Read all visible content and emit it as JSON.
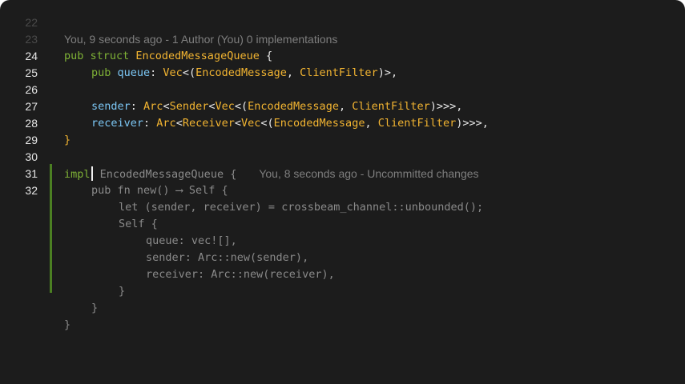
{
  "line_numbers": [
    "22",
    "23",
    "24",
    "25",
    "26",
    "27",
    "28",
    "29",
    "30",
    "31",
    "32"
  ],
  "blame_header": "You, 9 seconds ago - 1 Author (You) 0 implementations",
  "code": {
    "l24": {
      "kw": "pub struct ",
      "name": "EncodedMessageQueue",
      "brace": " {"
    },
    "l25": {
      "kw": "pub ",
      "field": "queue",
      "sep": ": ",
      "t1": "Vec",
      "p1": "<(",
      "t2": "EncodedMessage",
      "p2": ", ",
      "t3": "ClientFilter",
      "p3": ")>,"
    },
    "l27": {
      "field": "sender",
      "sep": ": ",
      "t1": "Arc",
      "p1": "<",
      "t2": "Sender",
      "p2": "<",
      "t3": "Vec",
      "p3": "<(",
      "t4": "EncodedMessage",
      "p4": ", ",
      "t5": "ClientFilter",
      "p5": ")>>>,"
    },
    "l28": {
      "field": "receiver",
      "sep": ": ",
      "t1": "Arc",
      "p1": "<",
      "t2": "Receiver",
      "p2": "<",
      "t3": "Vec",
      "p3": "<(",
      "t4": "EncodedMessage",
      "p4": ", ",
      "t5": "ClientFilter",
      "p5": ")>>>,"
    },
    "l29": "}",
    "l31": {
      "kw": "impl",
      "rest": " EncodedMessageQueue {",
      "blame": "You, 8 seconds ago - Uncommitted changes"
    },
    "l32": "pub fn new() ⟶ Self {",
    "l33": "let (sender, receiver) = crossbeam_channel::unbounded();",
    "l34": "Self {",
    "l35": "queue: vec![],",
    "l36": "sender: Arc::new(sender),",
    "l37": "receiver: Arc::new(receiver),",
    "l38": "}",
    "l39": "}",
    "l40": "}"
  }
}
